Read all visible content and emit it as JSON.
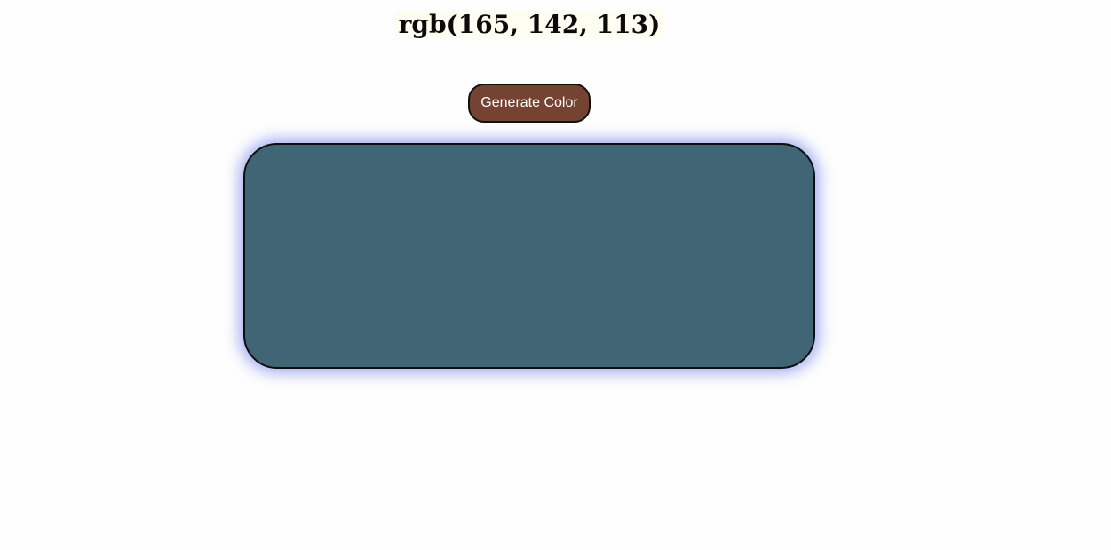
{
  "heading": {
    "text": "rgb(165, 142, 113)"
  },
  "controls": {
    "generate_label": "Generate Color",
    "button_color": "#754331"
  },
  "color_display": {
    "fill_color": "#406574",
    "glow_color": "#5a6ee6"
  }
}
